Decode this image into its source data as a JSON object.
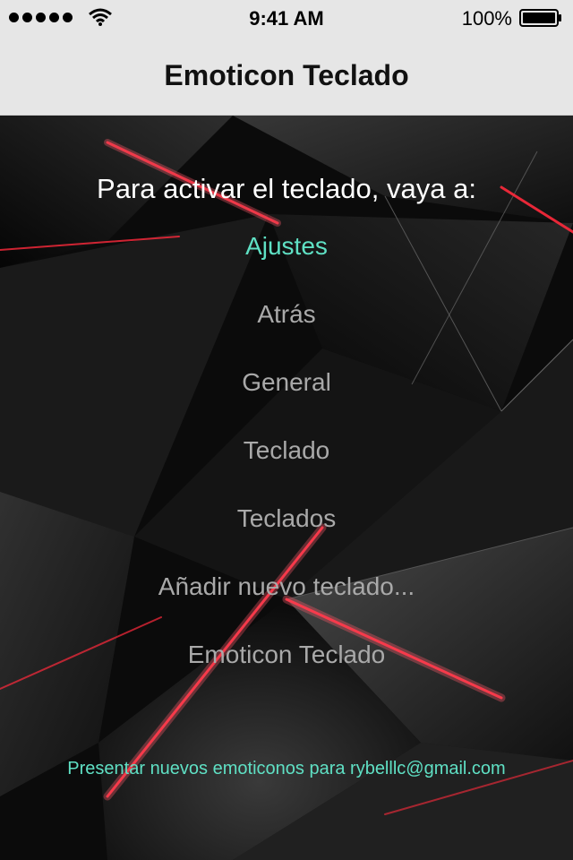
{
  "status_bar": {
    "time": "9:41 AM",
    "battery_percent": "100%",
    "signal_bars": 5
  },
  "nav": {
    "title": "Emoticon Teclado"
  },
  "instructions": {
    "intro": "Para activar el teclado, vaya a:",
    "steps": [
      {
        "label": "Ajustes",
        "active": true
      },
      {
        "label": "Atrás",
        "active": false
      },
      {
        "label": "General",
        "active": false
      },
      {
        "label": "Teclado",
        "active": false
      },
      {
        "label": "Teclados",
        "active": false
      },
      {
        "label": "Añadir nuevo teclado...",
        "active": false
      },
      {
        "label": "Emoticon Teclado",
        "active": false
      }
    ]
  },
  "footer": {
    "link": "Presentar nuevos emoticonos para rybelllc@gmail.com"
  },
  "colors": {
    "accent": "#5fe0c4",
    "step_text": "#a9a9a9",
    "bar_bg": "#e6e6e6",
    "glow_red": "#ff2a3c"
  }
}
